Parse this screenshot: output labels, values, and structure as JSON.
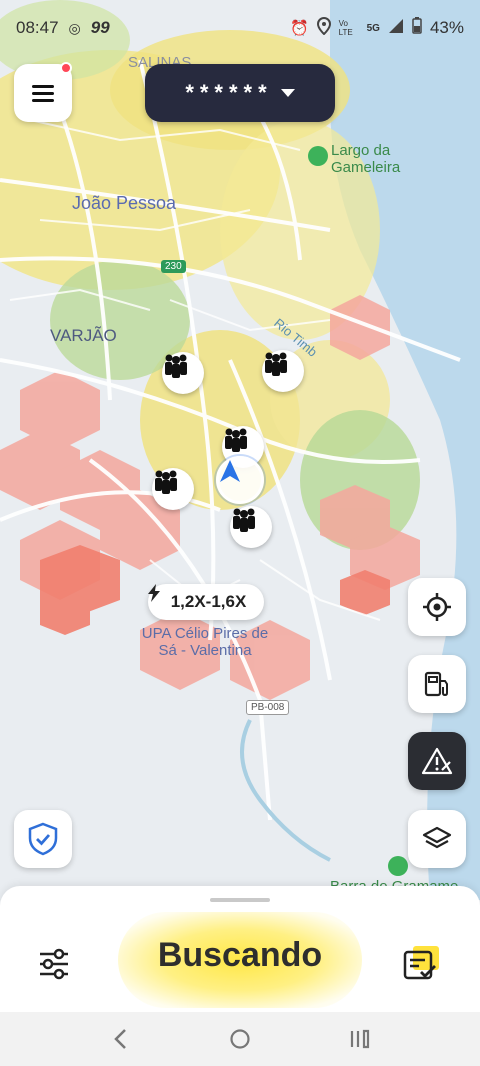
{
  "status_bar": {
    "time": "08:47",
    "app_badge": "99",
    "network": "5G",
    "volte": "Vo LTE",
    "battery": "43%"
  },
  "header": {
    "account_name_masked": "******"
  },
  "map": {
    "labels": {
      "salinas": "SALINAS",
      "joao_pessoa": "João Pessoa",
      "varjao": "VARJÃO",
      "largo_da_gameleira": "Largo da Gameleira",
      "rio_timb": "Rio Timb",
      "upa": "UPA Célio Pires de Sá - Valentina",
      "barra_do_gramame": "Barra do Gramame",
      "road_230": "230",
      "road_pb008": "PB-008"
    },
    "surge": "1,2X-1,6X"
  },
  "bottom_sheet": {
    "status_label": "Buscando"
  },
  "colors": {
    "accent_yellow": "#ffe23c",
    "pill_dark": "#272a3e",
    "shield_blue": "#2f6fd8",
    "surge_red": "#f27a6e"
  },
  "icons": {
    "menu": "hamburger-icon",
    "caret": "chevron-down-icon",
    "locate": "crosshair-icon",
    "fuel": "fuel-pump-icon",
    "alert": "warning-icon",
    "layers": "layers-icon",
    "shield": "shield-check-icon",
    "filters": "sliders-icon",
    "tasks": "checklist-icon"
  }
}
